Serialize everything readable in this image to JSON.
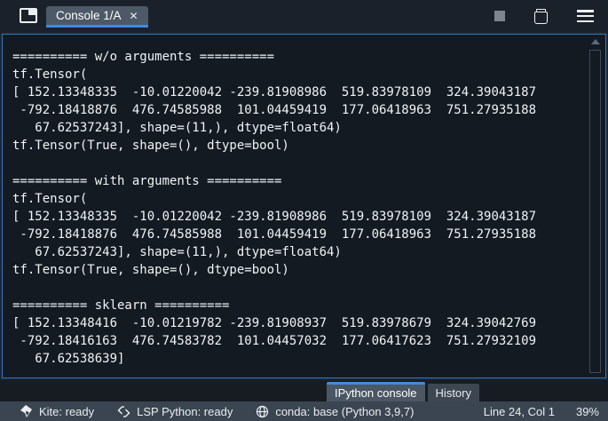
{
  "colors": {
    "accent_blue": "#3d8ae5",
    "pane_border_blue": "#2e79c2",
    "console_background": "#131a22",
    "topbar_background": "#1b212a",
    "statusbar_background": "#3b4551",
    "tab_background": "#4d5966"
  },
  "top_bar": {
    "browse_tabs_icon": "browse-tabs",
    "tab": {
      "label": "Console 1/A",
      "close_glyph": "✕"
    },
    "actions": [
      {
        "name": "interrupt-kernel",
        "icon": "stop-square"
      },
      {
        "name": "remove-all-variables",
        "icon": "trash"
      },
      {
        "name": "options-menu",
        "icon": "hamburger-menu"
      }
    ]
  },
  "console": {
    "lines": [
      "========== w/o arguments ==========",
      "tf.Tensor(",
      "[ 152.13348335  -10.01220042 -239.81908986  519.83978109  324.39043187",
      " -792.18418876  476.74585988  101.04459419  177.06418963  751.27935188",
      "   67.62537243], shape=(11,), dtype=float64)",
      "tf.Tensor(True, shape=(), dtype=bool)",
      "",
      "========== with arguments ==========",
      "tf.Tensor(",
      "[ 152.13348335  -10.01220042 -239.81908986  519.83978109  324.39043187",
      " -792.18418876  476.74585988  101.04459419  177.06418963  751.27935188",
      "   67.62537243], shape=(11,), dtype=float64)",
      "tf.Tensor(True, shape=(), dtype=bool)",
      "",
      "========== sklearn ==========",
      "[ 152.13348416  -10.01219782 -239.81908937  519.83978679  324.39042769",
      " -792.18416163  476.74583782  101.04457032  177.06417623  751.27932109",
      "   67.62538639]"
    ]
  },
  "bottom_tabs": [
    {
      "label": "IPython console",
      "active": true
    },
    {
      "label": "History",
      "active": false
    }
  ],
  "status_bar": {
    "kite": {
      "icon": "kite-icon",
      "label": "Kite: ready"
    },
    "lsp": {
      "icon": "lsp-icon",
      "label": "LSP Python: ready"
    },
    "conda": {
      "icon": "conda-icon",
      "label": "conda: base (Python 3,9,7)"
    },
    "cursor_position": "Line 24, Col 1",
    "memory_percent": "39%"
  }
}
